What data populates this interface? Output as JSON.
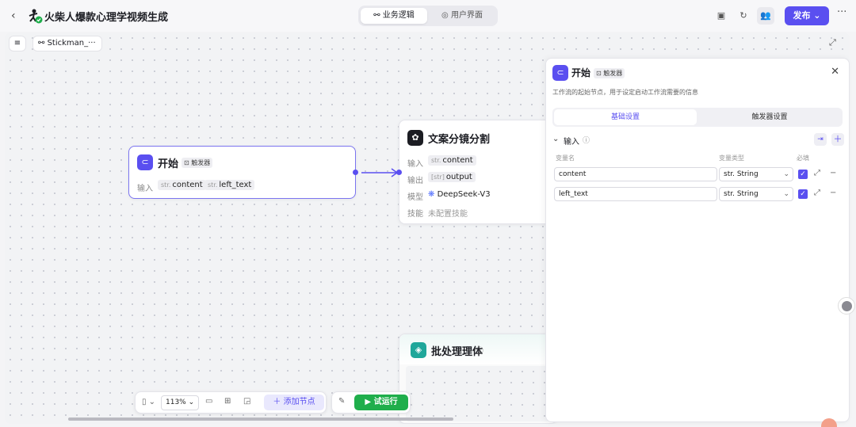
{
  "app": {
    "back_icon": "chevron-left-icon",
    "title": "火柴人爆款心理学视频生成"
  },
  "view_tabs": [
    {
      "label": "业务逻辑",
      "icon": "flow-icon",
      "active": true
    },
    {
      "label": "用户界面",
      "icon": "palette-icon",
      "active": false
    }
  ],
  "header_actions": {
    "publish_label": "发布",
    "more": "···"
  },
  "canvas_header": {
    "workflow_chip": "Stickman_···"
  },
  "nodes": {
    "start": {
      "title": "开始",
      "tag": "触发器",
      "input_label": "输入",
      "inputs": [
        {
          "type": "str.",
          "name": "content"
        },
        {
          "type": "str.",
          "name": "left_text"
        }
      ]
    },
    "copy_split": {
      "title": "文案分镜分割",
      "input_label": "输入",
      "input_type": "str.",
      "input_value": "content",
      "output_label": "输出",
      "output_type": "[str]",
      "output_value": "output",
      "model_label": "模型",
      "model_value": "DeepSeek-V3",
      "skill_label": "技能",
      "skill_value": "未配置技能"
    },
    "batch": {
      "title": "批处理理体"
    }
  },
  "panel": {
    "title": "开始",
    "tag": "触发器",
    "description": "工作流的起始节点，用于设定启动工作流需要的信息",
    "tabs": [
      "基础设置",
      "触发器设置"
    ],
    "section_label": "输入",
    "columns": {
      "name": "变量名",
      "type": "变量类型",
      "required": "必填"
    },
    "rows": [
      {
        "name": "content",
        "type": "str. String",
        "required": true
      },
      {
        "name": "left_text",
        "type": "str. String",
        "required": true
      }
    ]
  },
  "toolbar": {
    "zoom": "113%",
    "add_node_label": "添加节点",
    "run_label": "试运行"
  },
  "colors": {
    "accent": "#5a4ff0",
    "run": "#1fae4b",
    "node_border_selected": "#7b74f0"
  }
}
